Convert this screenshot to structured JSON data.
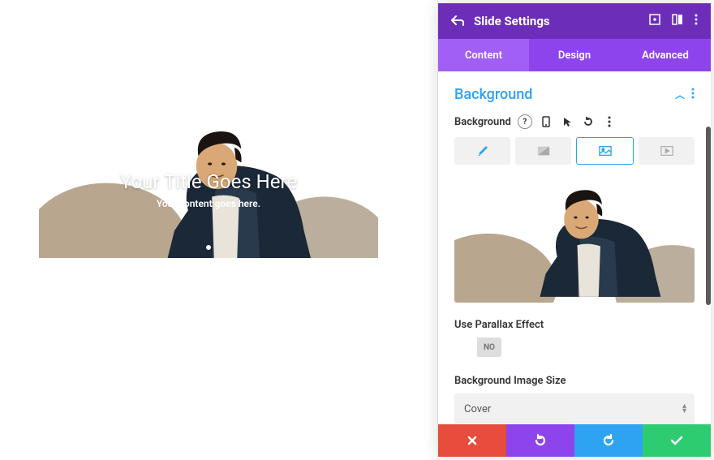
{
  "header": {
    "title": "Slide Settings"
  },
  "tabs": {
    "content": "Content",
    "design": "Design",
    "advanced": "Advanced"
  },
  "section": {
    "title": "Background"
  },
  "bg_field": {
    "label": "Background"
  },
  "parallax": {
    "label": "Use Parallax Effect",
    "value": "NO"
  },
  "bgsize": {
    "label": "Background Image Size",
    "value": "Cover"
  },
  "slide": {
    "title": "Your Title Goes Here",
    "subtitle": "Your content goes here."
  }
}
